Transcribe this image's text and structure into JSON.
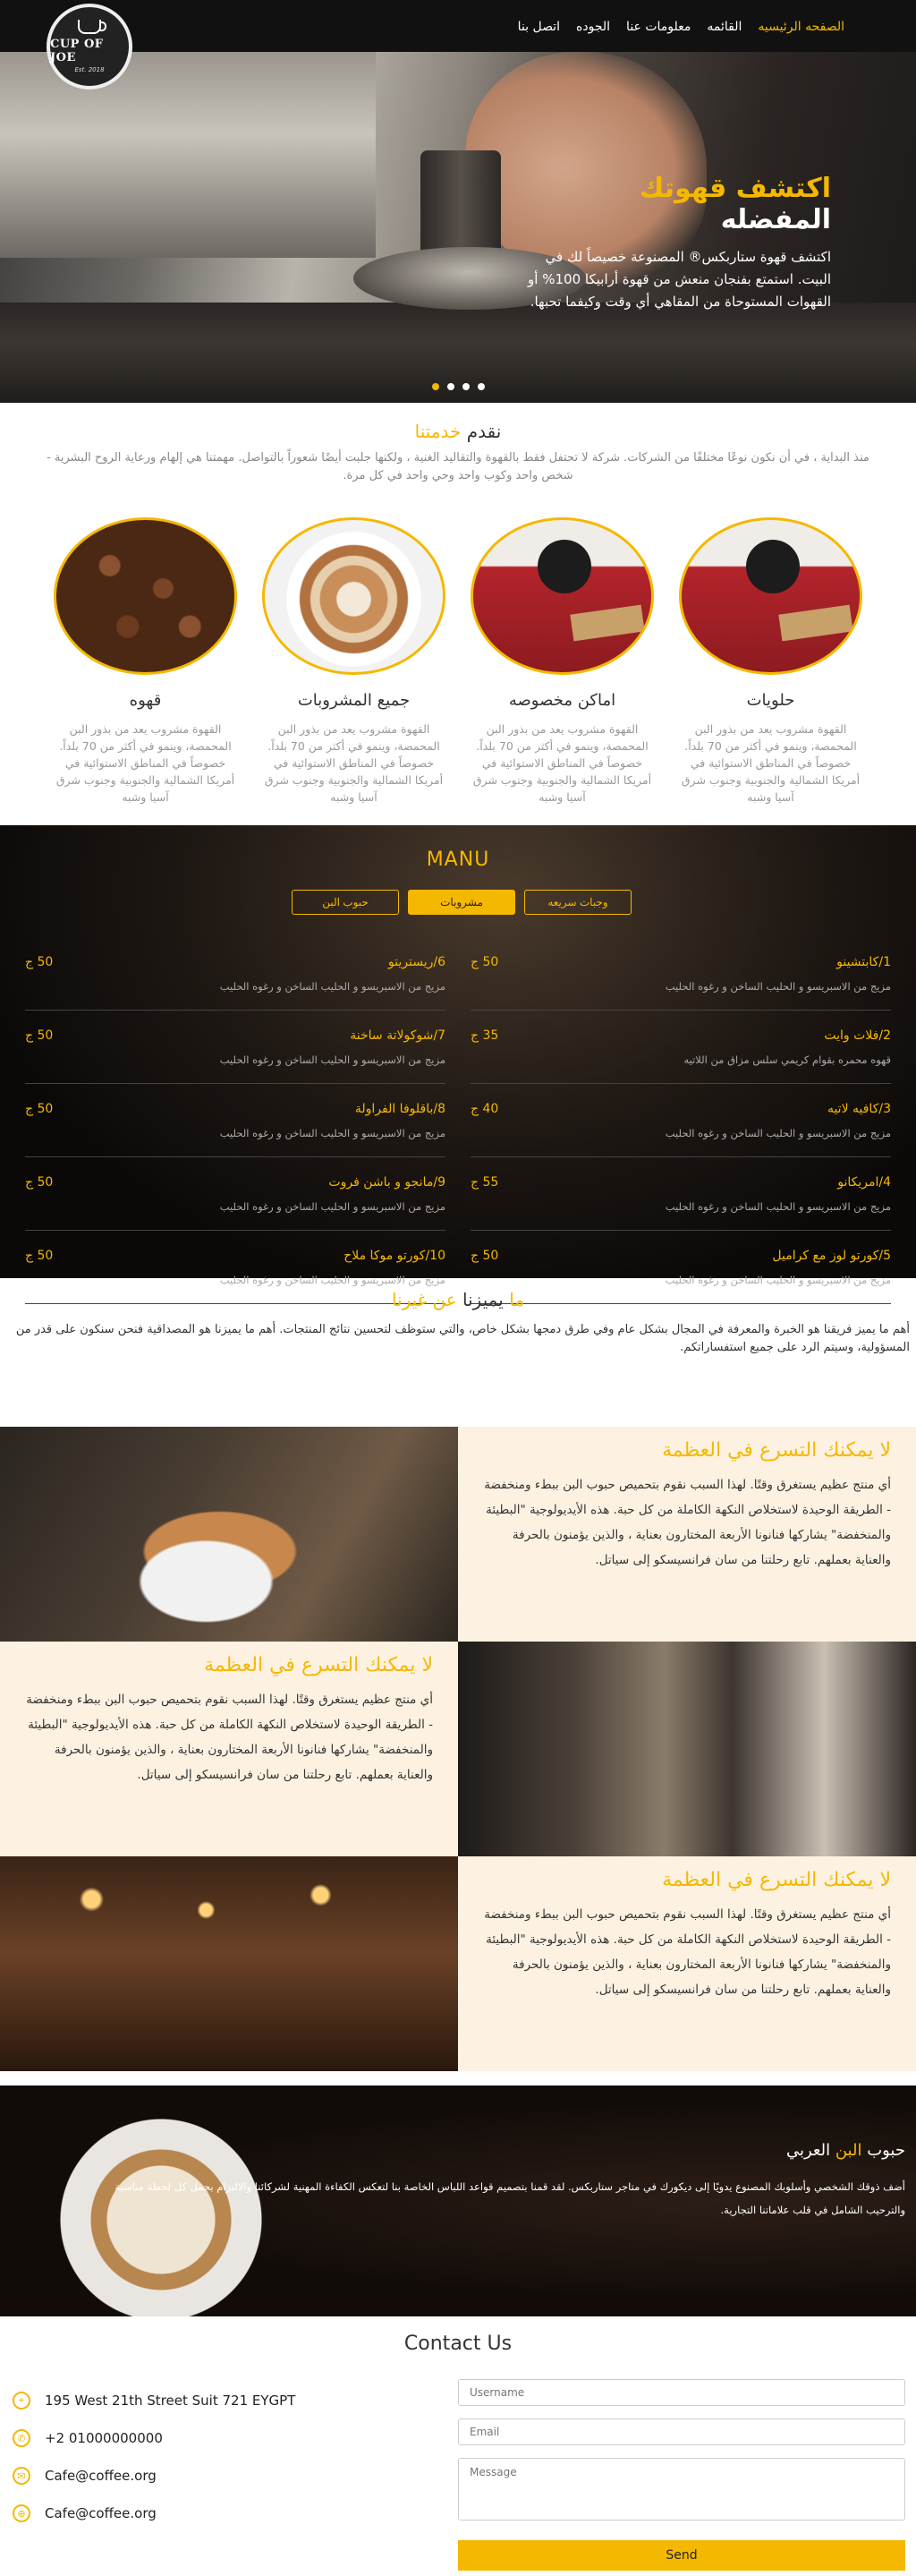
{
  "brand": {
    "logo_name": "CUP OF JOE",
    "logo_est": "Est. 2018"
  },
  "nav": {
    "items": [
      "الصفحه الرئيسيه",
      "القائمه",
      "معلومات عنا",
      "الجوده",
      "اتصل بنا"
    ],
    "active_index": 0
  },
  "hero": {
    "title_highlight": "اكتشف قهوتك",
    "title_rest": "المفضله",
    "description": "اكتشف قهوة ستاربكس® المصنوعة خصيصاً لك في البيت. استمتع بفنجان منعش من قهوة أرابيكا 100% أو القهوات المستوحاة من المقاهي أي وقت وكيفما تحبها.",
    "slides": 4,
    "active_slide": 0
  },
  "services": {
    "title_main": "نقدم",
    "title_highlight": "خدمتنا",
    "intro": "منذ البداية ، في أن نكون نوعًا مختلفًا من الشركات. شركة لا تحتفل فقط بالقهوة والتقاليد الغنية ، ولكنها جلبت أيضًا شعوراً بالتواصل. مهمتنا هي إلهام ورعاية الروح البشرية - شخص واحد وكوب واحد وحي واحد في كل مرة.",
    "items": [
      {
        "name": "حلويات",
        "image": "delivery-person",
        "desc": "القهوة مشروب يعد من بذور البن المحمصة، وينمو في أكثر من 70 بلداً. خصوصاً في المناطق الاستوائية في أمريكا الشمالية والجنوبية وجنوب شرق آسيا وشبه"
      },
      {
        "name": "اماكن مخصوصه",
        "image": "delivery-person",
        "desc": "القهوة مشروب يعد من بذور البن المحمصة، وينمو في أكثر من 70 بلداً. خصوصاً في المناطق الاستوائية في أمريكا الشمالية والجنوبية وجنوب شرق آسيا وشبه"
      },
      {
        "name": "جميع المشروبات",
        "image": "latte-art",
        "desc": "القهوة مشروب يعد من بذور البن المحمصة، وينمو في أكثر من 70 بلداً. خصوصاً في المناطق الاستوائية في أمريكا الشمالية والجنوبية وجنوب شرق آسيا وشبه"
      },
      {
        "name": "قهوه",
        "image": "coffee-beans",
        "desc": "القهوة مشروب يعد من بذور البن المحمصة، وينمو في أكثر من 70 بلداً. خصوصاً في المناطق الاستوائية في أمريكا الشمالية والجنوبية وجنوب شرق آسيا وشبه"
      }
    ]
  },
  "menu": {
    "title": "MANU",
    "tabs": [
      "وجبات سريعه",
      "مشروبات",
      "حبوب البن"
    ],
    "active_tab": 1,
    "right_column": [
      {
        "name": "1/كابتشينو",
        "desc": "مزيج من الاسبريسو و الحليب الساخن و رغوه الحليب",
        "price": "50 ج"
      },
      {
        "name": "2/فلات وايت",
        "desc": "قهوه محمره بقوام كريمي سلس مزاق من اللاتيه",
        "price": "35 ج"
      },
      {
        "name": "3/كافيه لاتيه",
        "desc": "مزيج من الاسبريسو و الحليب الساخن و رغوه الحليب",
        "price": "40 ج"
      },
      {
        "name": "4/امريكانو",
        "desc": "مزيج من الاسبريسو و الحليب الساخن و رغوه الحليب",
        "price": "55 ج"
      },
      {
        "name": "5/كورتو لوز مع كراميل",
        "desc": "مزيج من الاسبريسو و الحليب الساخن و رغوه الحليب",
        "price": "50 ج"
      }
    ],
    "left_column": [
      {
        "name": "6/ريستريتو",
        "desc": "مزيج من الاسبريسو و الحليب الساخن و رغوه الحليب",
        "price": "50 ج"
      },
      {
        "name": "7/شوكولاتة ساخنة",
        "desc": "مزيج من الاسبريسو و الحليب الساخن و رغوه الحليب",
        "price": "50 ج"
      },
      {
        "name": "8/باقلوفا الفراولة",
        "desc": "مزيج من الاسبريسو و الحليب الساخن و رغوه الحليب",
        "price": "50 ج"
      },
      {
        "name": "9/مانجو و باشن فروت",
        "desc": "مزيج من الاسبريسو و الحليب الساخن و رغوه الحليب",
        "price": "50 ج"
      },
      {
        "name": "10/كورتو موكا ملاح",
        "desc": "مزيج من الاسبريسو و الحليب الساخن و رغوه الحليب",
        "price": "50 ج"
      }
    ]
  },
  "why": {
    "title_a": "ما",
    "title_b": "يميزنا",
    "title_c": "عن غيرنا",
    "intro": "أهم ما يميز فريقنا هو الخبرة والمعرفة في المجال بشكل عام وفي طرق دمجها بشكل خاص، والتي ستوظف لتحسين نتائج المنتجات. أهم ما يميزنا هو المصداقية فنحن سنكون على قدر من المسؤولية، وسيتم الرد على جميع استفساراتكم.",
    "features": [
      {
        "title": "لا يمكنك التسرع في العظمة",
        "text": "أي منتج عظيم يستغرق وقتًا. لهذا السبب نقوم بتحميص حبوب البن ببطء ومنخفضة - الطريقة الوحيدة لاستخلاص النكهة الكاملة من كل حبة. هذه الأيديولوجية \"البطيئة والمنخفضة\" يشاركها فنانونا الأربعة المختارون بعناية ، والذين يؤمنون بالحرفة والعناية بعملهم. تابع رحلتنا من سان فرانسيسكو إلى سياتل.",
        "image": "latte-pour"
      },
      {
        "title": "لا يمكنك التسرع في العظمة",
        "text": "أي منتج عظيم يستغرق وقتًا. لهذا السبب نقوم بتحميص حبوب البن ببطء ومنخفضة - الطريقة الوحيدة لاستخلاص النكهة الكاملة من كل حبة. هذه الأيديولوجية \"البطيئة والمنخفضة\" يشاركها فنانونا الأربعة المختارون بعناية ، والذين يؤمنون بالحرفة والعناية بعملهم. تابع رحلتنا من سان فرانسيسكو إلى سياتل.",
        "image": "barista"
      },
      {
        "title": "لا يمكنك التسرع في العظمة",
        "text": "أي منتج عظيم يستغرق وقتًا. لهذا السبب نقوم بتحميص حبوب البن ببطء ومنخفضة - الطريقة الوحيدة لاستخلاص النكهة الكاملة من كل حبة. هذه الأيديولوجية \"البطيئة والمنخفضة\" يشاركها فنانونا الأربعة المختارون بعناية ، والذين يؤمنون بالحرفة والعناية بعملهم. تابع رحلتنا من سان فرانسيسكو إلى سياتل.",
        "image": "cafe-interior"
      }
    ]
  },
  "banner": {
    "title_main": "حبوب",
    "title_highlight": "البن",
    "title_rest": "العربي",
    "text": "أضف ذوقك الشخصي وأسلوبك المصنوع يدويًا إلى ديكورك في متاجر ستاربكس. لقد قمنا بتصميم قواعد اللباس الخاصة بنا لتعكس الكفاءة المهنية لشركائنا والالتزام بجمل كل لحظة مناسبة والترحيب الشامل في قلب علاماتنا التجارية."
  },
  "contact": {
    "title": "Contact Us",
    "items": [
      {
        "icon": "location-icon",
        "glyph": "⌖",
        "value": "195 West 21th Street Suit 721 EYGPT"
      },
      {
        "icon": "phone-icon",
        "glyph": "✆",
        "value": "+2 01000000000"
      },
      {
        "icon": "mail-icon",
        "glyph": "✉",
        "value": "Cafe@coffee.org"
      },
      {
        "icon": "globe-icon",
        "glyph": "⊕",
        "value": "Cafe@coffee.org"
      }
    ],
    "form": {
      "username_placeholder": "Username",
      "email_placeholder": "Email",
      "message_placeholder": "Message",
      "send_label": "Send"
    }
  },
  "colors": {
    "accent": "#f5b800",
    "dark": "#111111",
    "cream": "#fdf2e2"
  }
}
